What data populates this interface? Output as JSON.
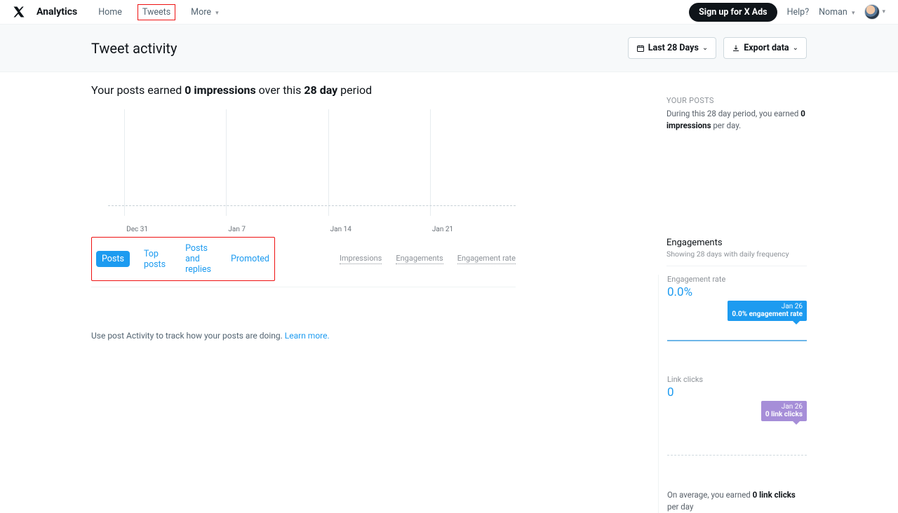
{
  "nav": {
    "brand": "Analytics",
    "items": [
      "Home",
      "Tweets",
      "More"
    ],
    "active_index": 1,
    "signup_label": "Sign up for X Ads",
    "help_label": "Help?",
    "username": "Noman"
  },
  "header": {
    "title": "Tweet activity",
    "daterange_label": "Last 28 Days",
    "export_label": "Export data"
  },
  "summary": {
    "prefix": "Your posts earned ",
    "impressions_bold": "0 impressions",
    "middle": " over this ",
    "period_bold": "28 day",
    "suffix": " period"
  },
  "chart_data": {
    "type": "bar",
    "categories": [
      "Dec 31",
      "Jan 7",
      "Jan 14",
      "Jan 21"
    ],
    "values": [
      0,
      0,
      0,
      0
    ],
    "ylim": [
      0,
      1
    ],
    "title": "",
    "xlabel": "",
    "ylabel": ""
  },
  "tabs": {
    "items": [
      "Posts",
      "Top posts",
      "Posts and replies",
      "Promoted"
    ],
    "active_index": 0
  },
  "metric_tabs": [
    "Impressions",
    "Engagements",
    "Engagement rate"
  ],
  "hint": {
    "text": "Use post Activity to track how your posts are doing. ",
    "link": "Learn more."
  },
  "side": {
    "your_posts_label": "YOUR POSTS",
    "your_posts_text_prefix": "During this 28 day period, you earned ",
    "your_posts_bold": "0 impressions",
    "your_posts_text_suffix": " per day.",
    "engagements_title": "Engagements",
    "engagements_sub": "Showing 28 days with daily frequency",
    "engagement_rate": {
      "label": "Engagement rate",
      "value": "0.0%",
      "callout_date": "Jan 26",
      "callout_value": "0.0% engagement rate"
    },
    "link_clicks": {
      "label": "Link clicks",
      "value": "0",
      "callout_date": "Jan 26",
      "callout_value": "0 link clicks"
    },
    "avg_prefix": "On average, you earned ",
    "avg_bold": "0 link clicks",
    "avg_suffix": " per day"
  }
}
